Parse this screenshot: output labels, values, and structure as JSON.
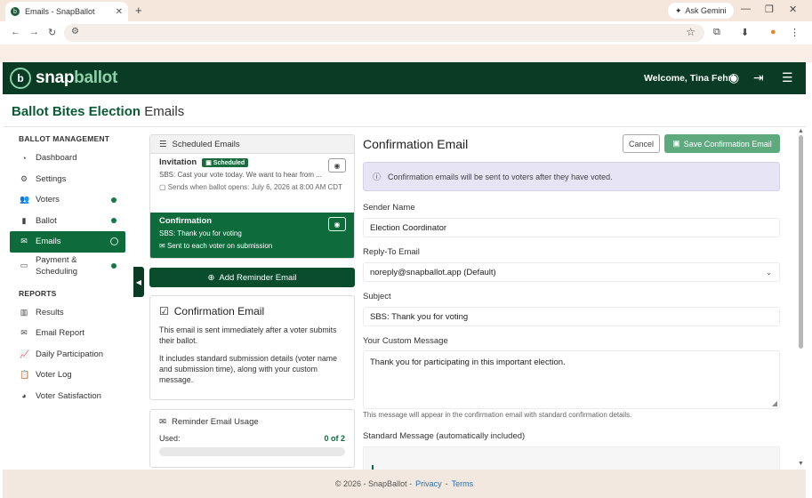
{
  "browser": {
    "tab_title": "Emails - SnapBallot",
    "new_tab": "+",
    "gemini": "Ask Gemini"
  },
  "header": {
    "logo_snap": "snap",
    "logo_ballot": "ballot",
    "welcome": "Welcome, Tina Fehr!"
  },
  "page": {
    "election_name": "Ballot Bites Election",
    "section": "Emails"
  },
  "sidebar": {
    "section1": "BALLOT MANAGEMENT",
    "items1": [
      {
        "label": "Dashboard"
      },
      {
        "label": "Settings"
      },
      {
        "label": "Voters"
      },
      {
        "label": "Ballot"
      },
      {
        "label": "Emails"
      },
      {
        "label_line1": "Payment &",
        "label_line2": "Scheduling"
      }
    ],
    "section2": "REPORTS",
    "items2": [
      {
        "label": "Results"
      },
      {
        "label": "Email Report"
      },
      {
        "label": "Daily Participation"
      },
      {
        "label": "Voter Log"
      },
      {
        "label": "Voter Satisfaction"
      }
    ]
  },
  "scheduled": {
    "heading": "Scheduled Emails",
    "invitation": {
      "title": "Invitation",
      "badge": "Scheduled",
      "subject": "SBS: Cast your vote today. We want to hear from ...",
      "meta": "Sends when ballot opens: July 6, 2026 at 8:00 AM CDT"
    },
    "confirmation": {
      "title": "Confirmation",
      "subject": "SBS: Thank you for voting",
      "meta": "Sent to each voter on submission"
    }
  },
  "add_reminder": "Add Reminder Email",
  "info": {
    "title": "Confirmation Email",
    "p1": "This email is sent immediately after a voter submits their ballot.",
    "p2": "It includes standard submission details (voter name and submission time), along with your custom message."
  },
  "usage": {
    "title": "Reminder Email Usage",
    "used_label": "Used:",
    "used_value": "0 of 2",
    "used_fraction": 0
  },
  "form": {
    "title": "Confirmation Email",
    "cancel": "Cancel",
    "save": "Save Confirmation Email",
    "notice": "Confirmation emails will be sent to voters after they have voted.",
    "sender_label": "Sender Name",
    "sender_value": "Election Coordinator",
    "reply_label": "Reply-To Email",
    "reply_value": "noreply@snapballot.app (Default)",
    "subject_label": "Subject",
    "subject_value": "SBS: Thank you for voting",
    "message_label": "Your Custom Message",
    "message_value": "Thank you for participating in this important election.",
    "help": "This message will appear in the confirmation email with standard confirmation details.",
    "standard_label": "Standard Message (automatically included)"
  },
  "footer": {
    "copy": "© 2026 - SnapBallot -",
    "privacy": "Privacy",
    "sep": "-",
    "terms": "Terms"
  },
  "colors": {
    "brand_dark": "#0a3b25",
    "brand_green": "#0d6b3c",
    "notice_bg": "#e6e4f5"
  }
}
